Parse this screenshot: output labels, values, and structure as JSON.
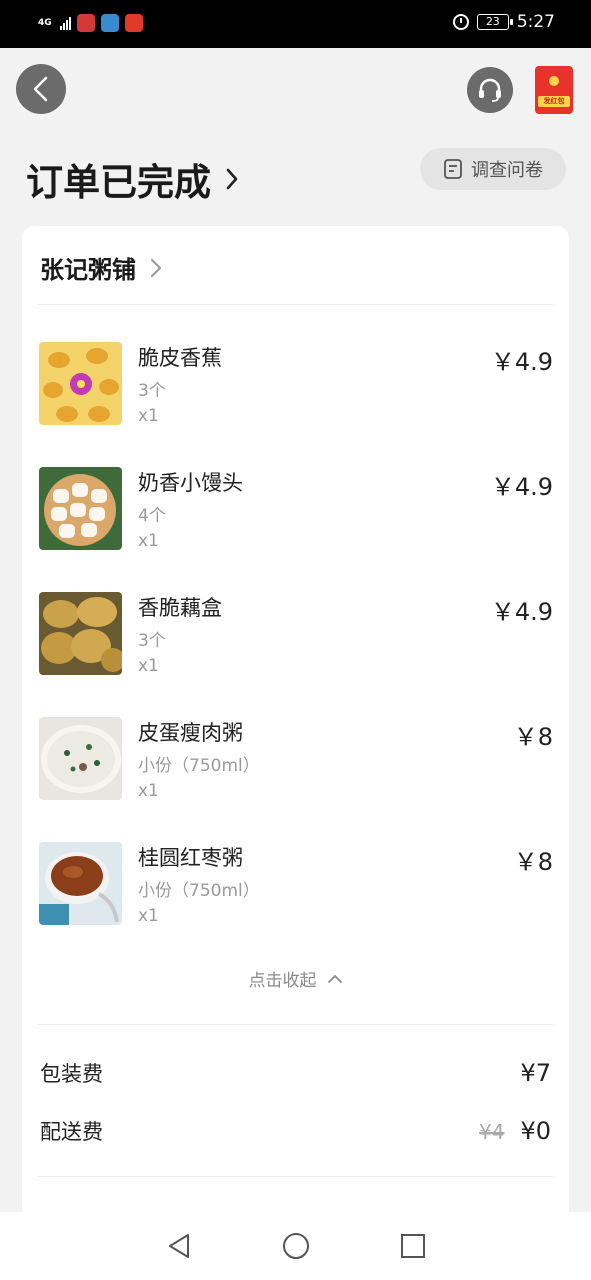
{
  "status_bar": {
    "network": "4G",
    "time": "5:27",
    "battery": "23"
  },
  "header": {
    "title": "订单已完成",
    "survey_label": "调查问卷",
    "red_packet_label": "发红包"
  },
  "shop": {
    "name": "张记粥铺"
  },
  "items": [
    {
      "name": "脆皮香蕉",
      "spec": "3个",
      "qty": "x1",
      "price": "￥4.9"
    },
    {
      "name": "奶香小馒头",
      "spec": "4个",
      "qty": "x1",
      "price": "￥4.9"
    },
    {
      "name": "香脆藕盒",
      "spec": "3个",
      "qty": "x1",
      "price": "￥4.9"
    },
    {
      "name": "皮蛋瘦肉粥",
      "spec": "小份（750ml）",
      "qty": "x1",
      "price": "￥8"
    },
    {
      "name": "桂圆红枣粥",
      "spec": "小份（750ml）",
      "qty": "x1",
      "price": "￥8"
    }
  ],
  "collapse_label": "点击收起",
  "fees": {
    "packaging_label": "包装费",
    "packaging_value": "¥7",
    "delivery_label": "配送费",
    "delivery_original": "¥4",
    "delivery_value": "¥0"
  },
  "colors": {
    "accent": "#e8322b",
    "status_bar": "#000000",
    "background": "#f2f2f2"
  }
}
